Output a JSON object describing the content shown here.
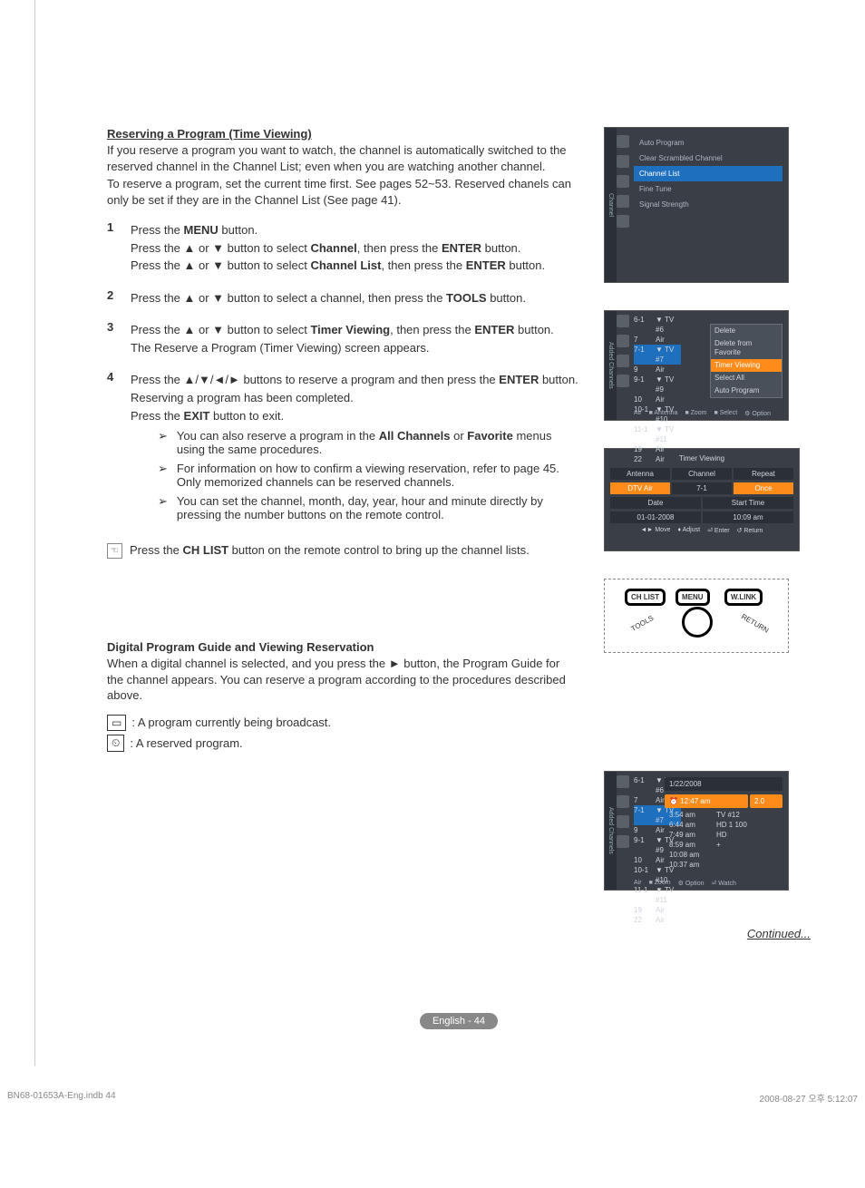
{
  "h1": "Reserving a Program (Time Viewing)",
  "intro1": "If you reserve a program you want to watch, the channel is automatically switched to the reserved channel in the Channel List; even when you are watching another channel.",
  "intro2": "To reserve a program, set the current time first. See pages 52~53. Reserved chanels can only be set if they are in the Channel List (See page 41).",
  "s1n": "1",
  "s1a": "Press the ",
  "s1b": "MENU",
  "s1c": " button.",
  "s1d": "Press the ▲ or ▼ button to select ",
  "s1e": "Channel",
  "s1f": ", then press the ",
  "s1g": "ENTER",
  "s1h": " button.",
  "s1i": "Press the ▲ or ▼ button to select ",
  "s1j": "Channel List",
  "s1k": ", then press the ",
  "s1l": "ENTER",
  "s1m": " button.",
  "s2n": "2",
  "s2a": "Press the ▲ or ▼ button to select a channel, then press the ",
  "s2b": "TOOLS",
  "s2c": " button.",
  "s3n": "3",
  "s3a": "Press the ▲ or ▼ button to select ",
  "s3b": "Timer Viewing",
  "s3c": ", then press the ",
  "s3d": "ENTER",
  "s3e": " button.",
  "s3f": "The Reserve a Program (Timer Viewing) screen appears.",
  "s4n": "4",
  "s4a": "Press the ▲/▼/◄/► buttons to reserve a program and then press the ",
  "s4b": "ENTER",
  "s4c": " button.",
  "s4d": "Reserving a program has been completed.",
  "s4e": "Press the ",
  "s4f": "EXIT",
  "s4g": " button to exit.",
  "n1": "➢",
  "n1a": "You can also reserve a program in the ",
  "n1b": "All Channels",
  "n1c": " or ",
  "n1d": "Favorite",
  "n1e": " menus using the same procedures.",
  "n2a": "For information on how to confirm a viewing reservation, refer to page 45. Only memorized channels can be reserved channels.",
  "n3a": "You can set the channel, month, day, year, hour and minute directly by pressing the number buttons on the remote control.",
  "hint": "Press the ",
  "hintb": "CH LIST",
  "hintc": " button on the remote control to bring up the channel lists.",
  "h2": "Digital Program Guide and Viewing Reservation",
  "h2p": "When a digital channel is selected, and you press the ► button, the Program Guide for the channel appears. You can reserve a program according to the procedures described above.",
  "leg1": ": A program currently being broadcast.",
  "leg2": ": A reserved program.",
  "cont": "Continued...",
  "page": "English - 44",
  "footL": "BN68-01653A-Eng.indb   44",
  "footR": "2008-08-27   오후 5:12:07",
  "fig1": {
    "tab": "Channel",
    "m1": "Auto Program",
    "m2": "Clear Scrambled Channel",
    "m3": "Channel List",
    "m4": "Fine Tune",
    "m5": "Signal Strength"
  },
  "fig2": {
    "tab": "Added Channels",
    "r": [
      [
        "6-1",
        "▼ TV #6"
      ],
      [
        "7",
        "Air"
      ],
      [
        "7-1",
        "▼ TV #7"
      ],
      [
        "9",
        "Air"
      ],
      [
        "9-1",
        "▼ TV #9"
      ],
      [
        "10",
        "Air"
      ],
      [
        "10-1",
        "▼ TV #10"
      ],
      [
        "11-1",
        "▼ TV #11"
      ],
      [
        "19",
        "Air"
      ],
      [
        "22",
        "Air"
      ]
    ],
    "pop": [
      "Delete",
      "Delete from Favorite",
      "Timer Viewing",
      "Select All",
      "Auto Program"
    ],
    "foot": [
      "Air",
      "■ Antenna",
      "■ Zoom",
      "■ Select",
      "⚙ Option"
    ]
  },
  "fig3": {
    "title": "Timer Viewing",
    "h": [
      "Antenna",
      "Channel",
      "Repeat"
    ],
    "v": [
      "DTV Air",
      "7-1",
      "Once"
    ],
    "h2": [
      "Date",
      "Start Time"
    ],
    "v2": [
      "01-01-2008",
      "10:09 am"
    ],
    "foot": [
      "◄► Move",
      "♦ Adjust",
      "⏎ Enter",
      "↺ Return"
    ]
  },
  "remote": {
    "b1": "CH LIST",
    "b2": "MENU",
    "b3": "W.LINK",
    "t": "TOOLS",
    "r": "RETURN"
  },
  "fig4": {
    "tab": "Added Channels",
    "r": [
      [
        "6-1",
        "▼ TV #6"
      ],
      [
        "7",
        "Air"
      ],
      [
        "7-1",
        "▼ TV #7"
      ],
      [
        "9",
        "Air"
      ],
      [
        "9-1",
        "▼ TV #9"
      ],
      [
        "10",
        "Air"
      ],
      [
        "10-1",
        "▼ TV #10"
      ],
      [
        "11-1",
        "▼ TV #11"
      ],
      [
        "19",
        "Air"
      ],
      [
        "22",
        "Air"
      ]
    ],
    "date": "1/22/2008",
    "sel": "⏰ 12:47 am",
    "selr": "2.0",
    "rows": [
      [
        "3:54 am",
        "TV #12"
      ],
      [
        "6:44 am",
        "HD 1 100"
      ],
      [
        "7:49 am",
        "HD"
      ],
      [
        "8:59 am",
        "+"
      ],
      [
        "10:08 am",
        ""
      ],
      [
        "10:37 am",
        ""
      ]
    ],
    "foot": [
      "Air",
      "■ Zoom",
      "⚙ Option",
      "⏎ Watch"
    ]
  }
}
